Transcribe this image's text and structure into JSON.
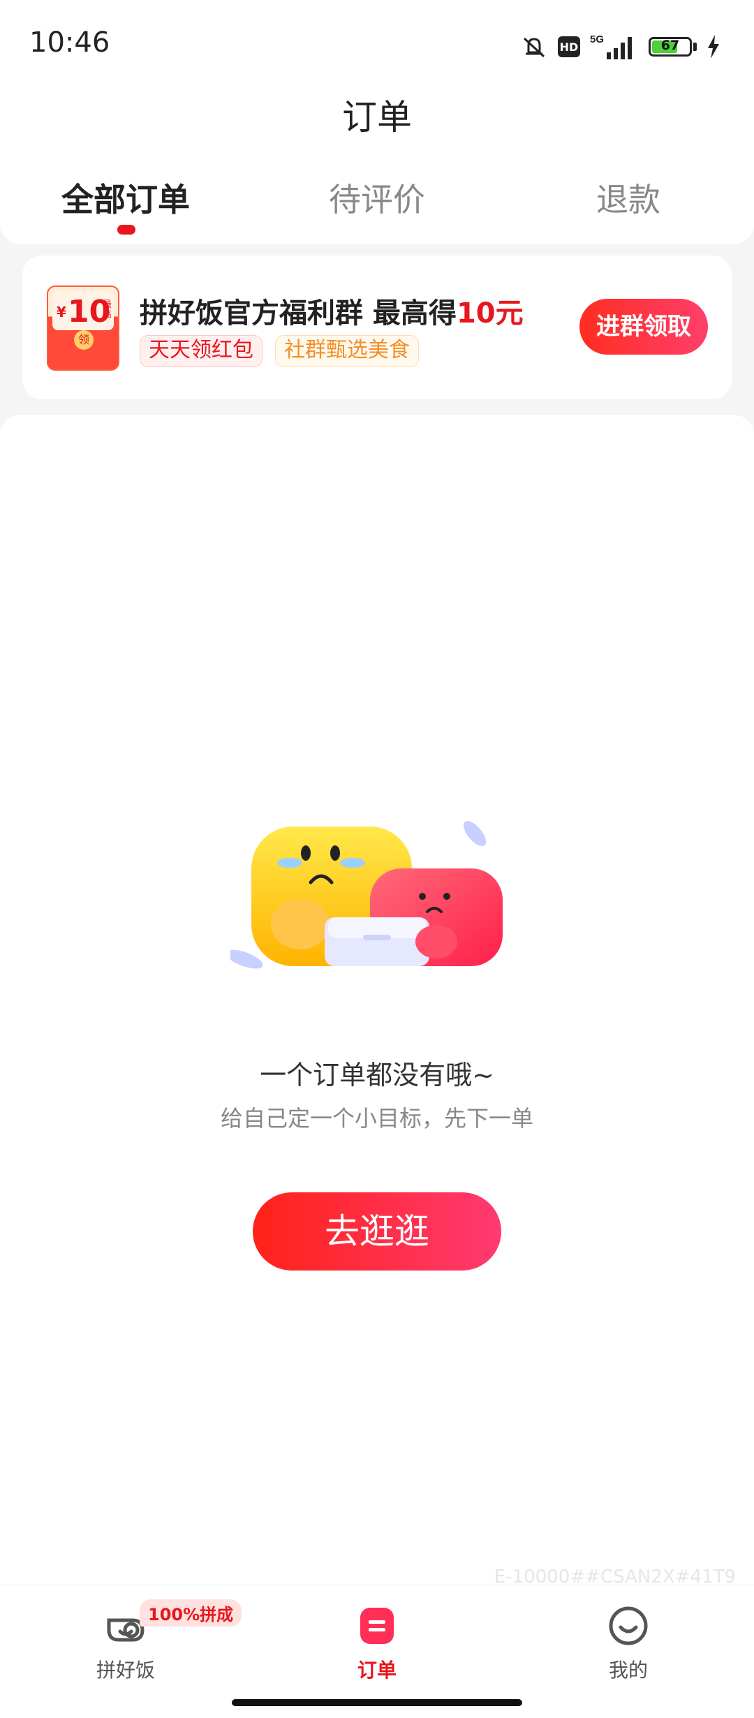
{
  "status_bar": {
    "time": "10:46",
    "network": "5G",
    "hd": "HD",
    "battery": "67"
  },
  "nav": {
    "title": "订单"
  },
  "tabs": [
    {
      "label": "全部订单",
      "active": true
    },
    {
      "label": "待评价",
      "active": false
    },
    {
      "label": "退款",
      "active": false
    }
  ],
  "banner": {
    "coupon_amount": "10",
    "coupon_currency": "¥",
    "coupon_max": "最高",
    "coupon_claim": "领",
    "title_prefix": "拼好饭官方福利群 最高得",
    "title_highlight": "10元",
    "tags": [
      "天天领红包",
      "社群甄选美食"
    ],
    "button": "进群领取"
  },
  "empty": {
    "title": "一个订单都没有哦~",
    "subtitle": "给自己定一个小目标，先下一单",
    "button": "去逛逛"
  },
  "watermark": "E-10000##CSAN2X#41T9",
  "bottom_nav": {
    "badge": "100%拼成",
    "items": [
      {
        "label": "拼好饭",
        "icon": "bowl-icon"
      },
      {
        "label": "订单",
        "icon": "order-icon",
        "active": true
      },
      {
        "label": "我的",
        "icon": "smile-icon"
      }
    ]
  },
  "colors": {
    "accent": "#e8161d",
    "accent_gradient_end": "#ff3a72"
  }
}
